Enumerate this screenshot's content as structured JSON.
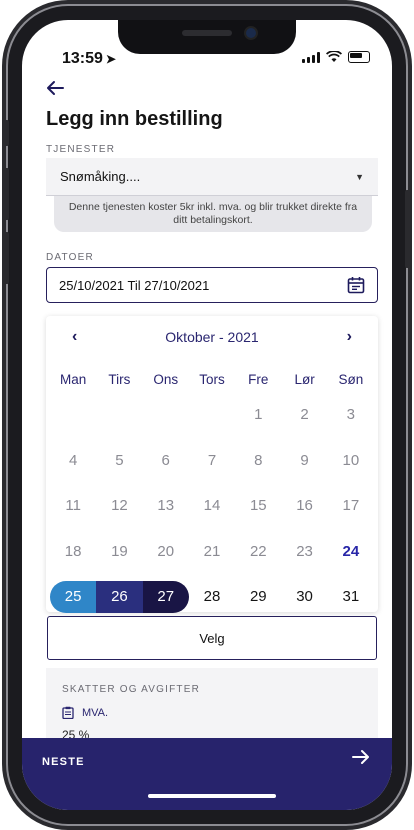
{
  "status": {
    "time": "13:59",
    "location_glyph": "➤"
  },
  "header": {
    "back_icon": "arrow-left-icon",
    "title": "Legg inn bestilling"
  },
  "services": {
    "label": "TJENESTER",
    "selected": "Snømåking....",
    "note": "Denne tjenesten koster 5kr inkl. mva. og blir trukket direkte fra ditt betalingskort."
  },
  "dates": {
    "label": "DATOER",
    "value": "25/10/2021 Til 27/10/2021",
    "icon": "calendar-icon"
  },
  "calendar": {
    "month_title": "Oktober - 2021",
    "prev": "‹",
    "next": "›",
    "weekdays": [
      "Man",
      "Tirs",
      "Ons",
      "Tors",
      "Fre",
      "Lør",
      "Søn"
    ],
    "weeks": [
      [
        "",
        "",
        "",
        "",
        "1",
        "2",
        "3"
      ],
      [
        "4",
        "5",
        "6",
        "7",
        "8",
        "9",
        "10"
      ],
      [
        "11",
        "12",
        "13",
        "14",
        "15",
        "16",
        "17"
      ],
      [
        "18",
        "19",
        "20",
        "21",
        "22",
        "23",
        "24"
      ],
      [
        "25",
        "26",
        "27",
        "28",
        "29",
        "30",
        "31"
      ]
    ],
    "today": "24",
    "range_start": "25",
    "range_mid": "26",
    "range_end": "27",
    "select_label": "Velg"
  },
  "taxes": {
    "label": "SKATTER OG AVGIFTER",
    "item": "MVA.",
    "value": "25 %"
  },
  "footer": {
    "next_label": "NESTE",
    "arrow_icon": "arrow-right-icon"
  },
  "colors": {
    "primary": "#27236c",
    "range_start": "#2f86c8",
    "range_mid": "#2a2f7e",
    "range_end": "#191545",
    "today": "#2826a8"
  }
}
